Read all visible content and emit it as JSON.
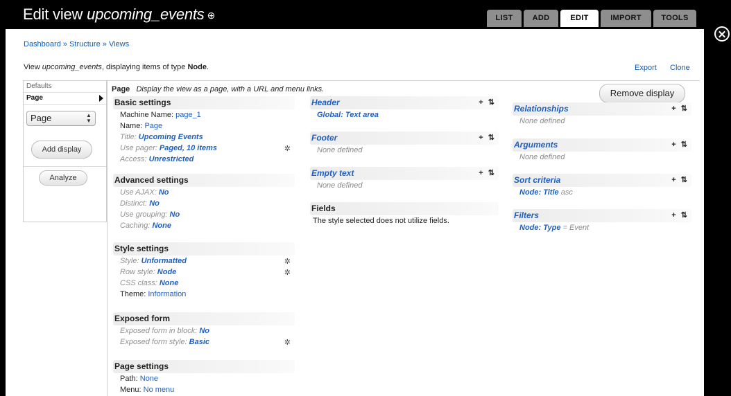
{
  "header": {
    "title_prefix": "Edit view ",
    "title_view": "upcoming_events",
    "title_icon": "⊕",
    "tabs": [
      "LIST",
      "ADD",
      "EDIT",
      "IMPORT",
      "TOOLS"
    ]
  },
  "breadcrumb": {
    "item1": "Dashboard",
    "sep": " » ",
    "item2": "Structure",
    "item3": "Views"
  },
  "viewdesc": {
    "pre": "View ",
    "name": "upcoming_events",
    "mid": ", displaying items of type ",
    "type": "Node",
    "end": "."
  },
  "links": {
    "export": "Export",
    "clone": "Clone"
  },
  "displays": {
    "defaults": "Defaults",
    "page": "Page",
    "select_value": "Page",
    "add_display": "Add display",
    "analyze": "Analyze"
  },
  "main": {
    "display_name": "Page",
    "display_desc": "Display the view as a page, with a URL and menu links.",
    "remove_display": "Remove display"
  },
  "basic": {
    "title": "Basic settings",
    "machine_k": "Machine Name: ",
    "machine_v": "page_1",
    "name_k": "Name: ",
    "name_v": "Page",
    "title_k": "Title: ",
    "title_v": "Upcoming Events",
    "pager_k": "Use pager: ",
    "pager_v": "Paged, 10 items",
    "access_k": "Access: ",
    "access_v": "Unrestricted"
  },
  "advanced": {
    "title": "Advanced settings",
    "ajax_k": "Use AJAX: ",
    "ajax_v": "No",
    "distinct_k": "Distinct: ",
    "distinct_v": "No",
    "grouping_k": "Use grouping: ",
    "grouping_v": "No",
    "caching_k": "Caching: ",
    "caching_v": "None"
  },
  "style": {
    "title": "Style settings",
    "style_k": "Style: ",
    "style_v": "Unformatted",
    "row_k": "Row style: ",
    "row_v": "Node",
    "css_k": "CSS class: ",
    "css_v": "None",
    "theme_k": "Theme: ",
    "theme_v": "Information"
  },
  "exposed": {
    "title": "Exposed form",
    "block_k": "Exposed form in block: ",
    "block_v": "No",
    "style_k": "Exposed form style: ",
    "style_v": "Basic"
  },
  "pagesettings": {
    "title": "Page settings",
    "path_k": "Path: ",
    "path_v": "None",
    "menu_k": "Menu: ",
    "menu_v": "No menu"
  },
  "middle": {
    "header_title": "Header",
    "header_item": "Global: Text area",
    "footer_title": "Footer",
    "footer_item": "None defined",
    "empty_title": "Empty text",
    "empty_item": "None defined",
    "fields_title": "Fields",
    "fields_item": "The style selected does not utilize fields."
  },
  "right": {
    "rel_title": "Relationships",
    "rel_item": "None defined",
    "args_title": "Arguments",
    "args_item": "None defined",
    "sort_title": "Sort criteria",
    "sort_item": "Node: Title",
    "sort_suffix": " asc",
    "filters_title": "Filters",
    "filters_item": "Node: Type",
    "filters_suffix": " = Event"
  },
  "ops_label": "+ ⇅",
  "gear": "✲",
  "colors": {
    "accent": "#1f5fbf",
    "topbar": "#000000",
    "tab": "#8e8e8e"
  }
}
